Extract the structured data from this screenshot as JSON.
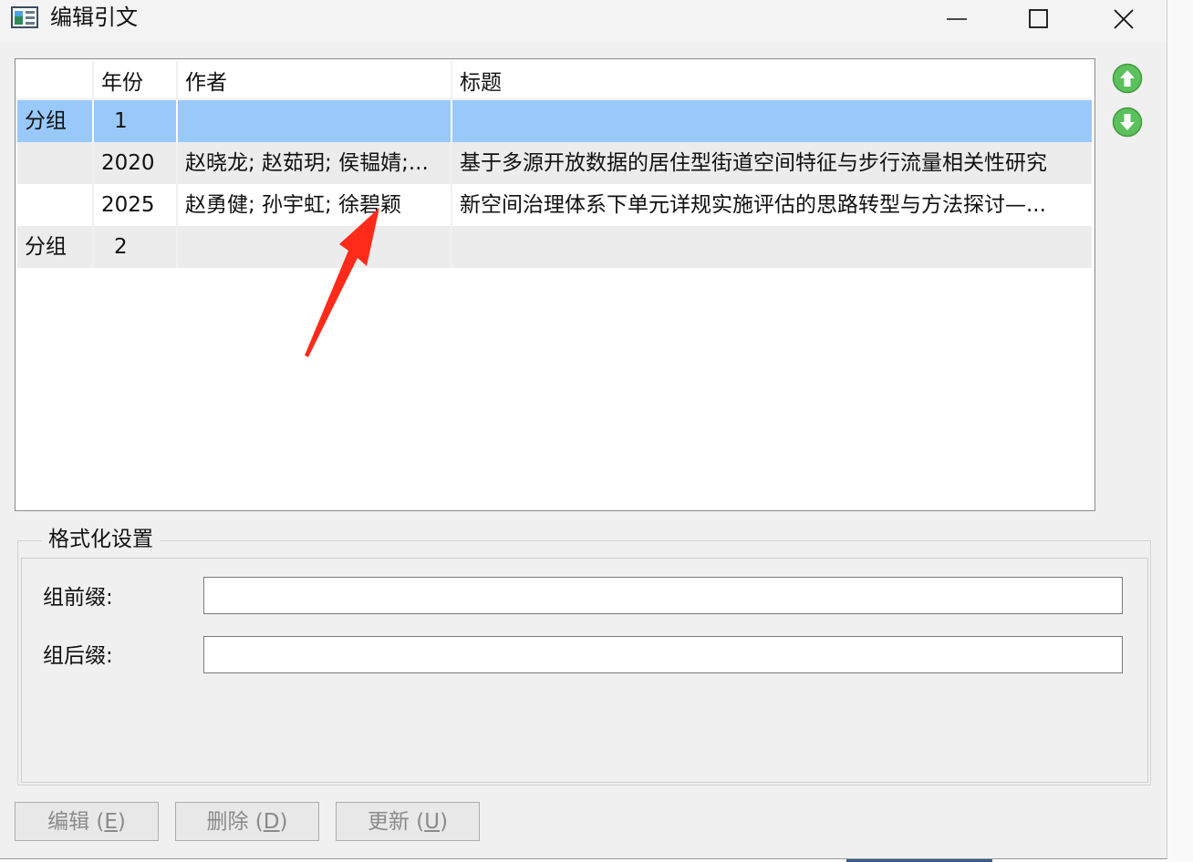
{
  "window": {
    "title": "编辑引文"
  },
  "list": {
    "headers": [
      "",
      "年份",
      "作者",
      "标题"
    ],
    "rows": [
      {
        "group": "分组",
        "year": "1",
        "author": "",
        "title": ""
      },
      {
        "group": "",
        "year": "2020",
        "author": "赵晓龙; 赵茹玥; 侯韫婧;...",
        "title": "基于多源开放数据的居住型街道空间特征与步行流量相关性研究"
      },
      {
        "group": "",
        "year": "2025",
        "author": "赵勇健; 孙宇虹; 徐碧颖",
        "title": "新空间治理体系下单元详规实施评估的思路转型与方法探讨—..."
      },
      {
        "group": "分组",
        "year": "2",
        "author": "",
        "title": ""
      }
    ]
  },
  "format": {
    "legend": "格式化设置",
    "prefix_label": "组前缀:",
    "suffix_label": "组后缀:",
    "prefix_value": "",
    "suffix_value": ""
  },
  "buttons": {
    "edit_text": "编辑 (",
    "edit_key": "E",
    "edit_end": ")",
    "delete_text": "删除 (",
    "delete_key": "D",
    "delete_end": ")",
    "update_text": "更新 (",
    "update_key": "U",
    "update_end": ")"
  },
  "icons": {
    "move_up": "arrow-up-circle-icon",
    "move_down": "arrow-down-circle-icon"
  },
  "colors": {
    "selection": "#99c9fb",
    "move_button": "#5cc05c",
    "annotation_arrow": "#ff2a1a"
  }
}
